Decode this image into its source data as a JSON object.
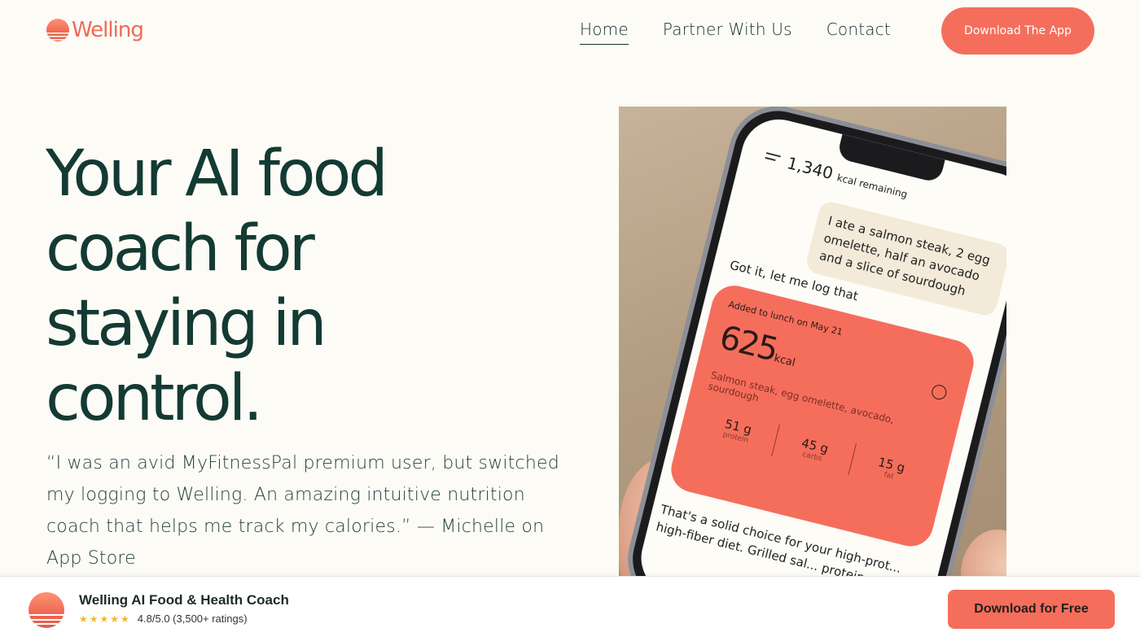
{
  "brand": {
    "name": "Welling",
    "color": "#f06a55"
  },
  "nav": {
    "items": [
      {
        "label": "Home",
        "active": true
      },
      {
        "label": "Partner With Us",
        "active": false
      },
      {
        "label": "Contact",
        "active": false
      }
    ],
    "cta_label": "Download The App"
  },
  "hero": {
    "title_lines": [
      "Your AI food",
      "coach for",
      "staying in",
      "control."
    ],
    "quote": "“I was an avid MyFitnessPal premium user, but switched my logging to Welling. An amazing intuitive nutrition coach that helps me track my calories.” — Michelle on App Store"
  },
  "phone": {
    "kcal_value": "1,340",
    "kcal_label": "kcal remaining",
    "user_message": "I ate a salmon steak, 2 egg omelette, half an avocado and a slice of sourdough",
    "bot_reply": "Got it, let me log that",
    "card": {
      "added_label": "Added to lunch on May 21",
      "kcal_value": "625",
      "kcal_unit": "kcal",
      "description": "Salmon steak, egg omelette, avocado, sourdough",
      "macros": [
        {
          "value": "51 g",
          "label": "protein"
        },
        {
          "value": "45 g",
          "label": "carbs"
        },
        {
          "value": "15 g",
          "label": "fat"
        }
      ]
    },
    "bot_followup": "That's a solid choice for your high-prot... high-fiber diet. Grilled sal... protein an..."
  },
  "app_bar": {
    "app_name": "Welling AI Food & Health Coach",
    "stars": "★★★★★",
    "rating_text": "4.8/5.0 (3,500+ ratings)",
    "cta_label": "Download for Free"
  },
  "colors": {
    "accent": "#f56e5c",
    "heading": "#133a33",
    "background": "#fcfbf6"
  }
}
